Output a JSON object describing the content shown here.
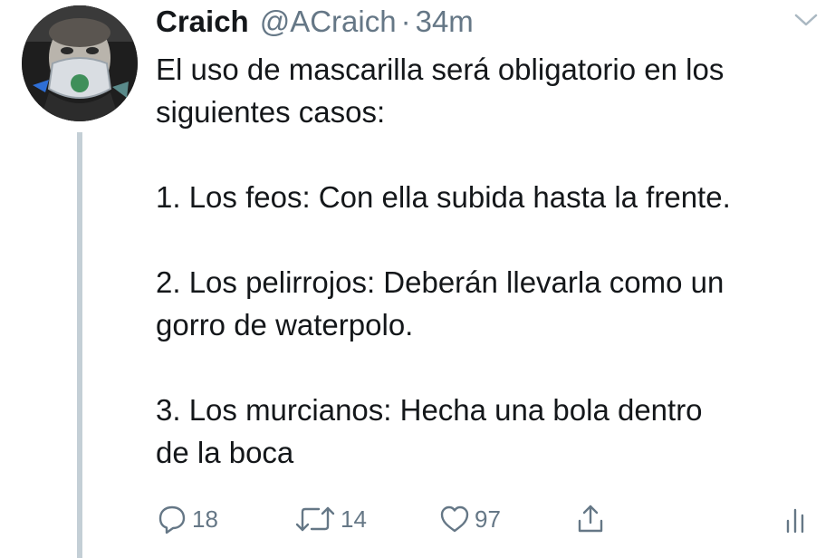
{
  "tweet": {
    "display_name": "Craich",
    "handle": "@ACraich",
    "separator": "·",
    "time": "34m",
    "text_lines": [
      "El uso de mascarilla será obligatorio en los",
      "siguientes casos:",
      "1. Los feos: Con ella subida hasta la frente.",
      "2. Los pelirrojos: Deberán llevarla como un",
      "gorro de waterpolo.",
      "3. Los murcianos: Hecha una bola dentro",
      "de la boca"
    ]
  },
  "actions": {
    "reply": {
      "icon": "reply-icon",
      "count": "18"
    },
    "retweet": {
      "icon": "retweet-icon",
      "count": "14"
    },
    "like": {
      "icon": "heart-icon",
      "count": "97"
    },
    "share": {
      "icon": "share-icon"
    },
    "analytics": {
      "icon": "analytics-icon"
    }
  },
  "colors": {
    "text": "#14171a",
    "secondary": "#657786",
    "thread_line": "#c4cfd6"
  }
}
